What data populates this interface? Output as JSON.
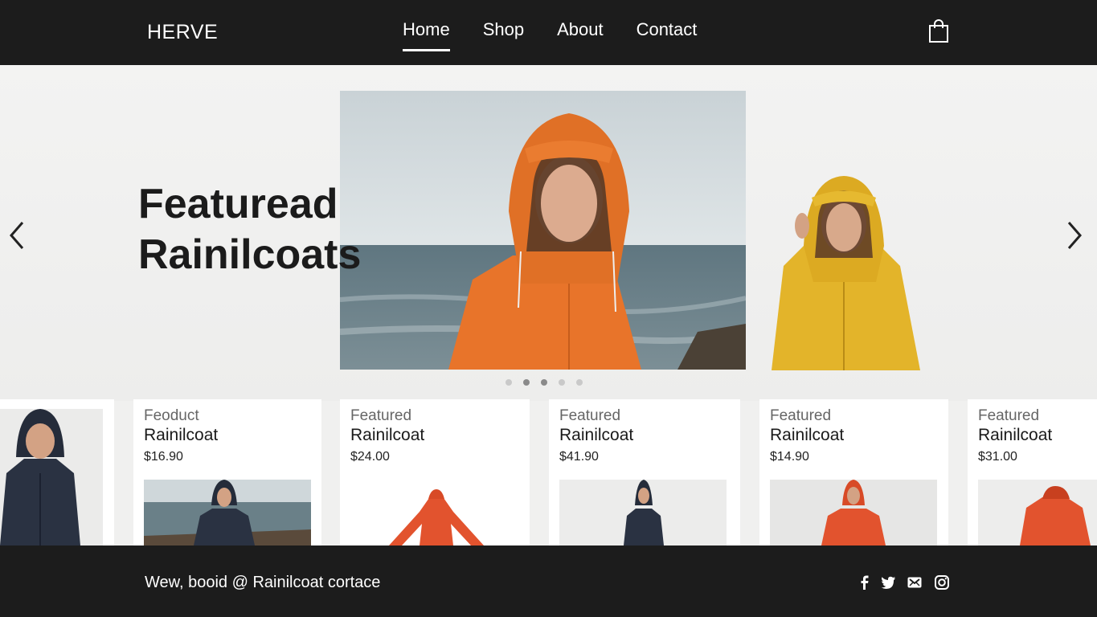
{
  "header": {
    "brand": "HERVE",
    "nav": [
      "Home",
      "Shop",
      "About",
      "Contact"
    ],
    "active_nav": "Home",
    "cart_icon": "shopping-bag-icon"
  },
  "hero": {
    "title_line1": "Featuread",
    "title_line2": "Rainilcoats",
    "prev_icon": "chevron-left-icon",
    "next_icon": "chevron-right-icon",
    "slides_count": 5,
    "active_slide": 2
  },
  "products": [
    {
      "category": "",
      "name": "",
      "price": ""
    },
    {
      "category": "Feoduct",
      "name": "Rainilcoat",
      "price": "$16.90"
    },
    {
      "category": "Featured",
      "name": "Rainilcoat",
      "price": "$24.00"
    },
    {
      "category": "Featured",
      "name": "Rainilcoat",
      "price": "$41.90"
    },
    {
      "category": "Featured",
      "name": "Rainilcoat",
      "price": "$14.90"
    },
    {
      "category": "Featured",
      "name": "Rainilcoat",
      "price": "$31.00"
    }
  ],
  "footer": {
    "text": "Wew, booid @ Rainilcoat cortace",
    "social_icons": [
      "facebook-icon",
      "twitter-icon",
      "mail-icon",
      "instagram-icon"
    ]
  },
  "colors": {
    "header_bg": "#1c1c1c",
    "orange_coat": "#e8742a",
    "yellow_coat": "#e3b42a",
    "navy_coat": "#2a3242",
    "red_coat": "#e2532e"
  }
}
